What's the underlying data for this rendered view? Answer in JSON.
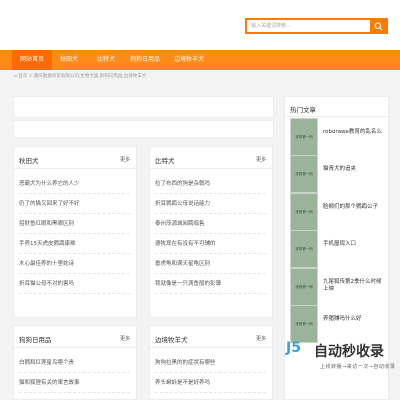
{
  "search": {
    "placeholder": "输入关键词搜索..."
  },
  "colors": {
    "accent": "#ff8a18",
    "accent_dark": "#ff6a00",
    "thumb": "#9bb59b"
  },
  "nav": {
    "items": [
      {
        "label": "网站首页"
      },
      {
        "label": "秋田犬"
      },
      {
        "label": "比特犬"
      },
      {
        "label": "狗狗日用品"
      },
      {
        "label": "边境牧羊犬"
      }
    ]
  },
  "breadcrumb": {
    "text": "首页 > 重庆勤春商贸有限公司,生物犬类,狗狗日用品,边境牧羊犬"
  },
  "sections": [
    {
      "title": "秋田犬",
      "more": "更多",
      "items": [
        "恶霸犬为什么养它的人少",
        "仍了的猫又回来了好不好",
        "招财鱼红眼和黑眼区别",
        "手养15天虎皮鹦鹉康难",
        "木心最佳养的十里蛇诗",
        "折耳猫公母不对的害吗"
      ]
    },
    {
      "title": "比特犬",
      "more": "更多",
      "items": [
        "拉了布西的狗是杂戟吗",
        "折耳鹦鹉公母说话能力",
        "泰州茂源城阅聘临售",
        "德牧现在有没有不可辅的",
        "垂虏龟和满天星龟区别",
        "我就像是一只滴鱼般的彭薄"
      ]
    },
    {
      "title": "狗狗日用品",
      "more": "更多",
      "items": [
        "白鹦和红莲星鸟哪个贵",
        "猫和狐狸有关的寓言故事"
      ]
    },
    {
      "title": "边境牧羊犬",
      "more": "更多",
      "items": [
        "狗狗拉黑的的症状有哪些",
        "养头蝌蚪是不是好养吗"
      ]
    }
  ],
  "sidebar": {
    "title": "热门文章",
    "thumb_label": "宠物第一网",
    "items": [
      {
        "text": "roborawe教育的乱名么"
      },
      {
        "text": "猫青犬的追夹"
      },
      {
        "text": "脸颊们的那个鹦鹉公子"
      },
      {
        "text": "手机屋现入口"
      },
      {
        "text": "九尾狐传第2季什么时候上映"
      },
      {
        "text": "养猪赚吗什么好"
      }
    ]
  },
  "watermark": {
    "logo": "J5",
    "text": "自动秒收录",
    "sub": "上线转播→来访一次→自动收录"
  }
}
